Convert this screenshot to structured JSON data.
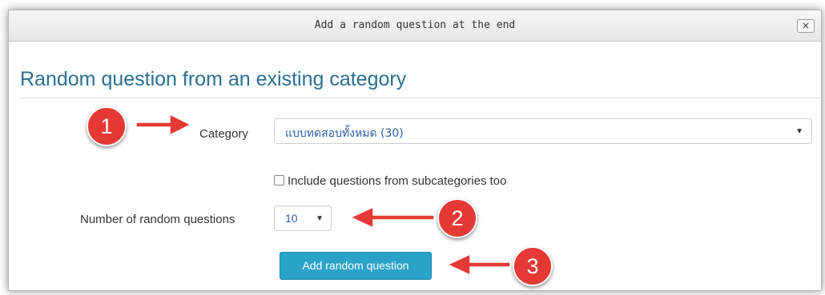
{
  "dialog": {
    "title": "Add a random question at the end",
    "close_icon": "close-icon",
    "close_label": "×"
  },
  "form": {
    "heading": "Random question from an existing category",
    "category_label": "Category",
    "category_value": "แบบทดสอบทั้งหมด (30)",
    "include_sub_label": "Include questions from subcategories too",
    "number_label": "Number of random questions",
    "number_value": "10",
    "submit_label": "Add random question"
  },
  "annotations": {
    "markers": [
      "1",
      "2",
      "3"
    ],
    "color": "#e53935"
  }
}
